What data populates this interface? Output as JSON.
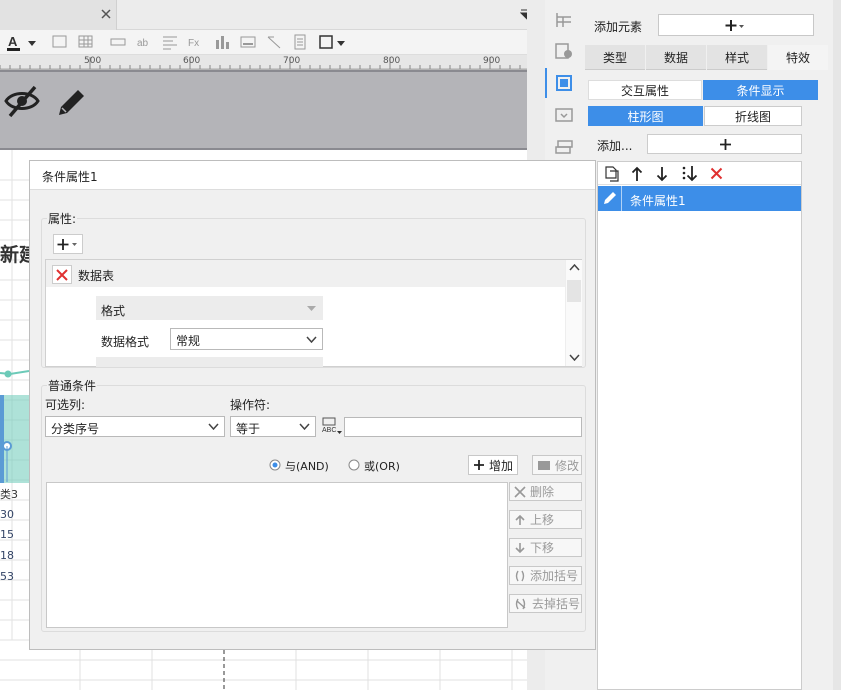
{
  "editor": {
    "ruler_ticks": [
      "500",
      "600",
      "700",
      "800",
      "900"
    ],
    "canvas_title": "新建",
    "left_labels": [
      "类3",
      "30",
      "15",
      "18",
      "53"
    ]
  },
  "side_icons": [
    "cell-icon",
    "widget-settings-icon",
    "select-frame-icon",
    "dropdown-icon",
    "stack-icon"
  ],
  "right_panel": {
    "add_element_label": "添加元素",
    "tabs": [
      "类型",
      "数据",
      "样式",
      "特效"
    ],
    "subtabs": [
      "交互属性",
      "条件显示"
    ],
    "chart_tabs": [
      "柱形图",
      "折线图"
    ],
    "add_label": "添加...",
    "condition_item": "条件属性1"
  },
  "dialog": {
    "title": "条件属性1",
    "attr_group_label": "属性:",
    "attr_item_label": "数据表",
    "format_label": "格式",
    "data_format_label": "数据格式",
    "data_format_value": "常规",
    "cond_group_label": "普通条件",
    "col_label": "可选列:",
    "col_value": "分类序号",
    "op_label": "操作符:",
    "op_value": "等于",
    "and_label": "与(AND)",
    "or_label": "或(OR)",
    "add_btn": "增加",
    "edit_btn": "修改",
    "delete_btn": "删除",
    "up_btn": "上移",
    "down_btn": "下移",
    "add_bracket_btn": "添加括号",
    "remove_bracket_btn": "去掉括号"
  },
  "colors": {
    "accent": "#3d8ee8",
    "delete_red": "#e03030",
    "canvas_gray": "#b4b4b8"
  }
}
